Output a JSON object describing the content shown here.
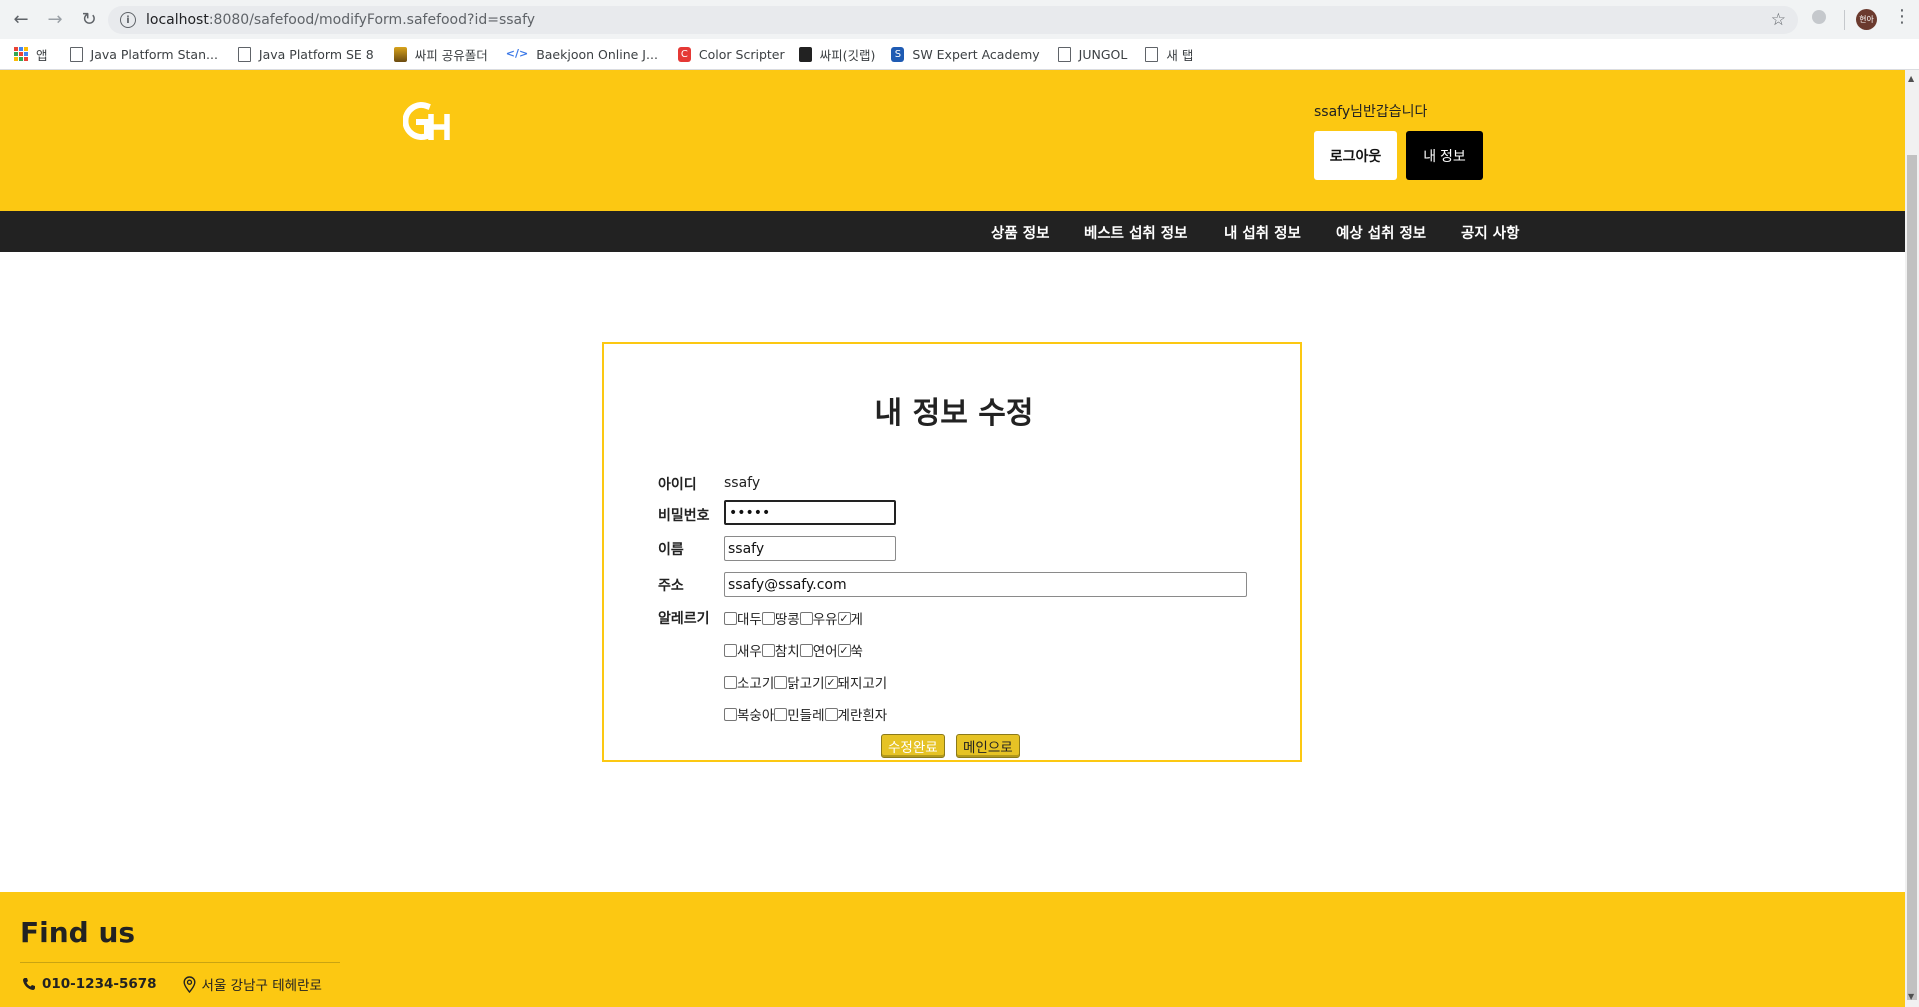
{
  "browser": {
    "url_host": "localhost",
    "url_path": ":8080/safefood/modifyForm.safefood?id=ssafy",
    "profile_label": "현아"
  },
  "bookmarks": [
    {
      "label": "앱",
      "icon": "apps-icon"
    },
    {
      "label": "Java Platform Stan...",
      "icon": "page-icon"
    },
    {
      "label": "Java Platform SE 8",
      "icon": "page-icon"
    },
    {
      "label": "싸피 공유폴더",
      "icon": "folder-icon"
    },
    {
      "label": "Baekjoon Online J...",
      "icon": "code-icon"
    },
    {
      "label": "Color Scripter",
      "icon": "colorscripter-icon"
    },
    {
      "label": "싸피(깃랩)",
      "icon": "gitlab-icon"
    },
    {
      "label": "SW Expert Academy",
      "icon": "swea-icon"
    },
    {
      "label": "JUNGOL",
      "icon": "page-icon"
    },
    {
      "label": "새 탭",
      "icon": "page-icon"
    }
  ],
  "header": {
    "greeting": "ssafy님반갑습니다",
    "logout": "로그아웃",
    "myinfo": "내 정보",
    "brand_color": "#fcc812"
  },
  "nav": [
    {
      "label": "상품 정보"
    },
    {
      "label": "베스트 섭취 정보"
    },
    {
      "label": "내 섭취 정보"
    },
    {
      "label": "예상 섭취 정보"
    },
    {
      "label": "공지 사항"
    }
  ],
  "form": {
    "title": "내 정보 수정",
    "id_label": "아이디",
    "id_value": "ssafy",
    "password_label": "비밀번호",
    "password_value": "•••••",
    "name_label": "이름",
    "name_value": "ssafy",
    "address_label": "주소",
    "address_value": "ssafy@ssafy.com",
    "allergy_label": "알레르기",
    "allergy_rows": [
      [
        {
          "label": "대두",
          "checked": false
        },
        {
          "label": "땅콩",
          "checked": false
        },
        {
          "label": "우유",
          "checked": false
        },
        {
          "label": "게",
          "checked": true
        }
      ],
      [
        {
          "label": "새우",
          "checked": false
        },
        {
          "label": "참치",
          "checked": false
        },
        {
          "label": "연어",
          "checked": false
        },
        {
          "label": "쑥",
          "checked": true
        }
      ],
      [
        {
          "label": "소고기",
          "checked": false
        },
        {
          "label": "닭고기",
          "checked": false
        },
        {
          "label": "돼지고기",
          "checked": true
        }
      ],
      [
        {
          "label": "복숭아",
          "checked": false
        },
        {
          "label": "민들레",
          "checked": false
        },
        {
          "label": "계란흰자",
          "checked": false
        }
      ]
    ],
    "submit": "수정완료",
    "to_main": "메인으로"
  },
  "footer": {
    "title": "Find us",
    "phone": "010-1234-5678",
    "address": "서울 강남구 테헤란로"
  }
}
